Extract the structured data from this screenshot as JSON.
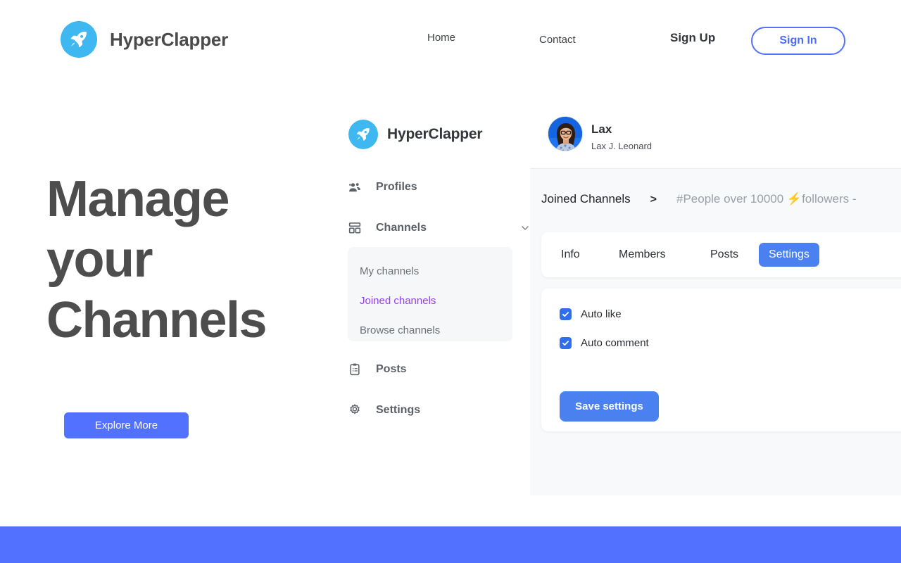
{
  "site": {
    "brand": "HyperClapper",
    "logo_icon": "rocket-icon",
    "accent_blue": "#5271FF",
    "logo_bg": "#3FB7F0"
  },
  "topnav": {
    "items": [
      {
        "label": "Home",
        "name": "nav-home"
      },
      {
        "label": "Contact",
        "name": "nav-contact"
      },
      {
        "label": "Sign Up",
        "name": "nav-signup"
      }
    ],
    "signin_label": "Sign In"
  },
  "hero": {
    "title": "Manage your Channels",
    "cta_label": "Explore More"
  },
  "app": {
    "brand": "HyperClapper",
    "sidebar": {
      "items": [
        {
          "label": "Profiles",
          "icon": "people-icon"
        },
        {
          "label": "Channels",
          "icon": "grid-icon",
          "chevron": "chevron-down-icon"
        },
        {
          "label": "Posts",
          "icon": "clipboard-icon"
        },
        {
          "label": "Settings",
          "icon": "gear-icon"
        }
      ],
      "submenu": [
        {
          "label": "My channels",
          "active": false
        },
        {
          "label": "Joined channels",
          "active": true
        },
        {
          "label": "Browse channels",
          "active": false
        }
      ],
      "active_color": "#9340F5"
    },
    "profile": {
      "name": "Lax",
      "full_name": "Lax J. Leonard",
      "avatar": "user-photo"
    },
    "breadcrumb": {
      "root": "Joined Channels",
      "separator": ">",
      "current_prefix": "#People over 10000 ",
      "current_bolt": "⚡",
      "current_suffix": "followers -"
    },
    "tabs": [
      {
        "label": "Info",
        "active": false
      },
      {
        "label": "Members",
        "active": false
      },
      {
        "label": "Posts",
        "active": false
      },
      {
        "label": "Settings",
        "active": true
      }
    ],
    "settings": {
      "checkboxes": [
        {
          "label": "Auto like",
          "checked": true
        },
        {
          "label": "Auto comment",
          "checked": true
        }
      ],
      "save_label": "Save settings"
    }
  }
}
